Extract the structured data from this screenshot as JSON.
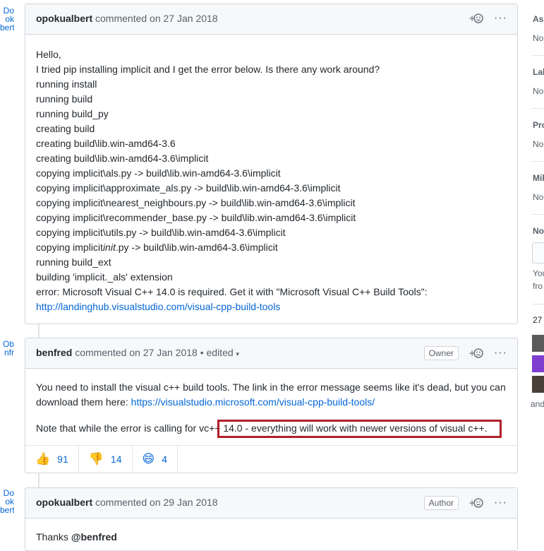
{
  "left_fragments": [
    {
      "lines": [
        "Do",
        "ok",
        "bert"
      ]
    },
    {
      "lines": [
        "Ob",
        "nfr"
      ]
    },
    {
      "lines": [
        "Do",
        "ok",
        "bert"
      ]
    }
  ],
  "comments": [
    {
      "author": "opokualbert",
      "action": "commented on",
      "date": "27 Jan 2018",
      "body_lines": [
        "Hello,",
        "I tried pip installing implicit and I get the error below. Is there any work around?",
        "running install",
        "running build",
        "running build_py",
        "creating build",
        "creating build\\lib.win-amd64-3.6",
        "creating build\\lib.win-amd64-3.6\\implicit",
        "copying implicit\\als.py -> build\\lib.win-amd64-3.6\\implicit",
        "copying implicit\\approximate_als.py -> build\\lib.win-amd64-3.6\\implicit",
        "copying implicit\\nearest_neighbours.py -> build\\lib.win-amd64-3.6\\implicit",
        "copying implicit\\recommender_base.py -> build\\lib.win-amd64-3.6\\implicit",
        "copying implicit\\utils.py -> build\\lib.win-amd64-3.6\\implicit",
        "building 'implicit._als' extension",
        "error: Microsoft Visual C++ 14.0 is required. Get it with \"Microsoft Visual C++ Build Tools\":"
      ],
      "init_line": {
        "prefix": "copying implicit",
        "italic": "init",
        "suffix": ".py -> build\\lib.win-amd64-3.6\\implicit"
      },
      "build_ext_line": "running build_ext",
      "link": "http://landinghub.visualstudio.com/visual-cpp-build-tools"
    },
    {
      "author": "benfred",
      "action": "commented on",
      "date": "27 Jan 2018",
      "edited": "• edited",
      "badge": "Owner",
      "para1": "You need to install the visual c++ build tools. The link in the error message seems like it's dead, but you can download them here:",
      "para1_link": "https://visualstudio.microsoft.com/visual-cpp-build-tools/",
      "para2": "Note that while the error is calling for vc++ 14.0 - everything will work with newer versions of visual c++.",
      "reactions": [
        {
          "icon": "thumbs-up-icon",
          "glyph": "👍",
          "count": "91"
        },
        {
          "icon": "thumbs-down-icon",
          "glyph": "👎",
          "count": "14"
        },
        {
          "icon": "laugh-icon",
          "glyph": "😄",
          "count": "4"
        }
      ]
    },
    {
      "author": "opokualbert",
      "action": "commented on",
      "date": "29 Jan 2018",
      "badge": "Author",
      "body_prefix": "Thanks ",
      "mention": "@benfred"
    }
  ],
  "sidebar": {
    "items": [
      {
        "heading": "Ass",
        "value": "No"
      },
      {
        "heading": "Lab",
        "value": "No"
      },
      {
        "heading": "Pro",
        "value": "No"
      },
      {
        "heading": "Mil",
        "value": "No"
      },
      {
        "heading": "No",
        "value": ""
      }
    ],
    "notif_lines": [
      "You",
      "fro"
    ],
    "participants_count": "27",
    "and_text": "and"
  },
  "colors": {
    "link": "#0366d6",
    "highlight": "#b0202a",
    "border": "#d1d5da",
    "header_bg": "#f6f8fa"
  }
}
